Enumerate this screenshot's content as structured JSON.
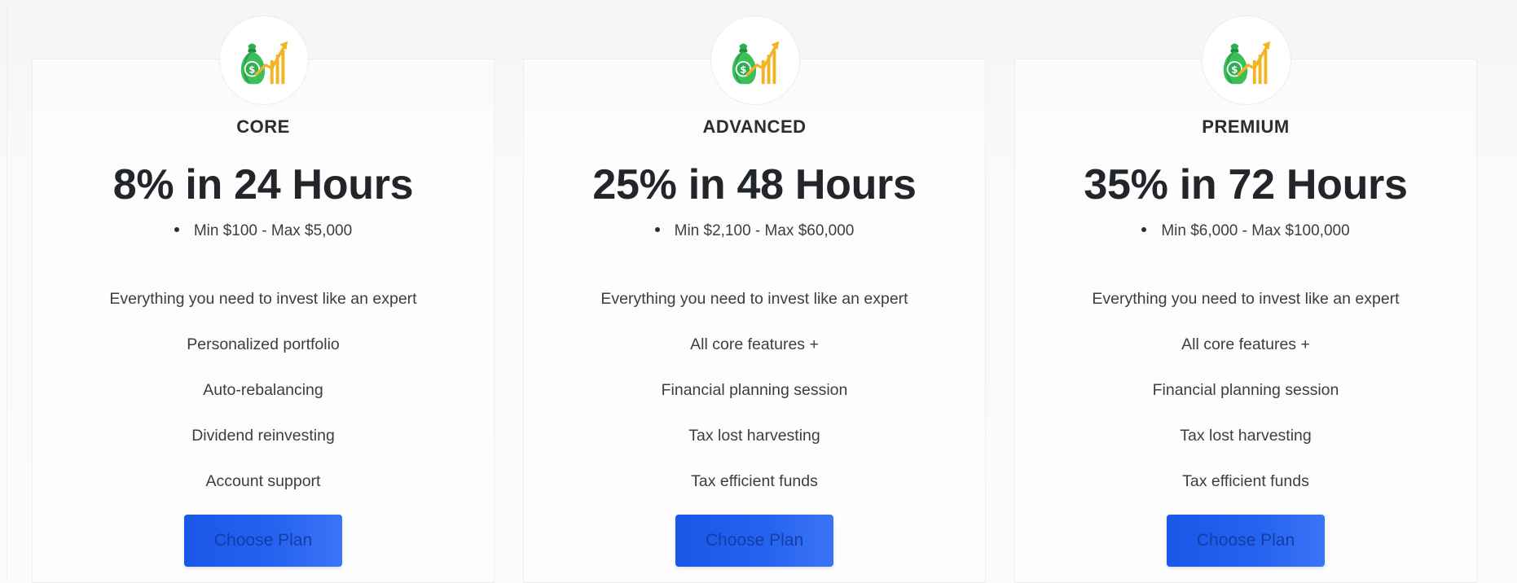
{
  "plans": [
    {
      "icon": "money-bag-growth-icon",
      "tier": "CORE",
      "rate": "8% in 24 Hours",
      "range": "Min $100 - Max $5,000",
      "features": [
        "Everything you need to invest like an expert",
        "Personalized portfolio",
        "Auto-rebalancing",
        "Dividend reinvesting",
        "Account support"
      ],
      "button_label": "Choose Plan"
    },
    {
      "icon": "money-bag-growth-icon",
      "tier": "ADVANCED",
      "rate": "25% in 48 Hours",
      "range": "Min $2,100 - Max $60,000",
      "features": [
        "Everything you need to invest like an expert",
        "All core features +",
        "Financial planning session",
        "Tax lost harvesting",
        "Tax efficient funds"
      ],
      "button_label": "Choose Plan"
    },
    {
      "icon": "money-bag-growth-icon",
      "tier": "PREMIUM",
      "rate": "35% in 72 Hours",
      "range": "Min $6,000 - Max $100,000",
      "features": [
        "Everything you need to invest like an expert",
        "All core features +",
        "Financial planning session",
        "Tax lost harvesting",
        "Tax efficient funds"
      ],
      "button_label": "Choose Plan"
    }
  ],
  "colors": {
    "button_gradient_start": "#1a57e8",
    "button_gradient_end": "#3b74f5",
    "button_text": "#153da6",
    "bag_green": "#2fae4f",
    "chart_gold": "#f2b424"
  }
}
